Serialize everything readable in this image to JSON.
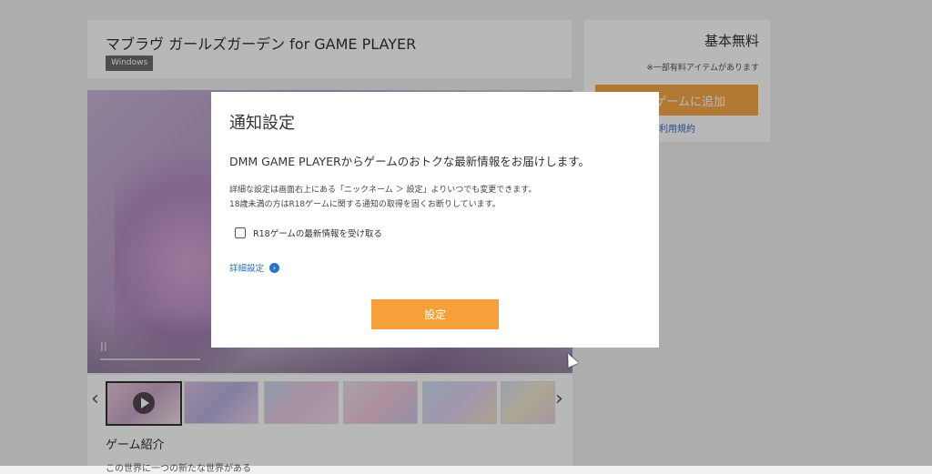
{
  "game": {
    "title": "マブラヴ ガールズガーデン for GAME PLAYER",
    "platform": "Windows"
  },
  "side": {
    "price": "基本無料",
    "price_note": "※一部有料アイテムがあります",
    "add_button": "ゲームに追加",
    "terms_link": "利用規約"
  },
  "media": {
    "play_symbol": "II",
    "prev_arrow": "‹",
    "next_arrow": "›"
  },
  "intro": {
    "title": "ゲーム紹介",
    "text": "この世界に一つの新たな世界がある"
  },
  "modal": {
    "title": "通知設定",
    "lead": "DMM GAME PLAYERからゲームのおトクな最新情報をお届けします。",
    "note1": "詳細な設定は画面右上にある「ニックネーム ＞ 設定」よりいつでも変更できます。",
    "note2": "18歳未満の方はR18ゲームに関する通知の取得を固くお断りしています。",
    "checkbox_label": "R18ゲームの最新情報を受け取る",
    "detail_link": "詳細設定",
    "submit": "設定"
  },
  "colors": {
    "accent_orange": "#f7a03a",
    "link_blue": "#2f6db3"
  }
}
